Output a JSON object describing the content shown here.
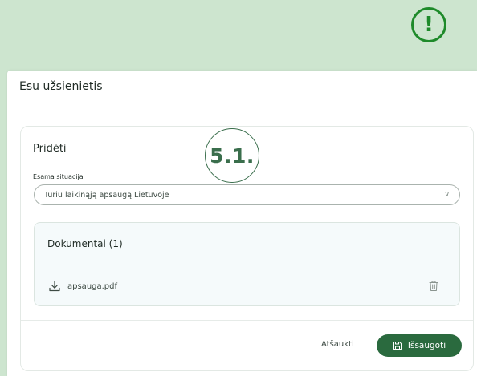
{
  "alert": {
    "symbol": "!"
  },
  "modal": {
    "title": "Esu užsienietis",
    "card": {
      "title": "Pridėti",
      "step_badge": "5.1.",
      "field": {
        "label": "Esama situacija",
        "selected_value": "Turiu laikinąją apsaugą Lietuvoje"
      },
      "documents": {
        "header": "Dokumentai (1)",
        "items": [
          {
            "name": "apsauga.pdf"
          }
        ]
      }
    },
    "footer": {
      "cancel_label": "Atšaukti",
      "save_label": "Išsaugoti"
    }
  },
  "colors": {
    "background": "#cde5cf",
    "accent": "#2a6a3e",
    "alert": "#1e8a2a"
  }
}
